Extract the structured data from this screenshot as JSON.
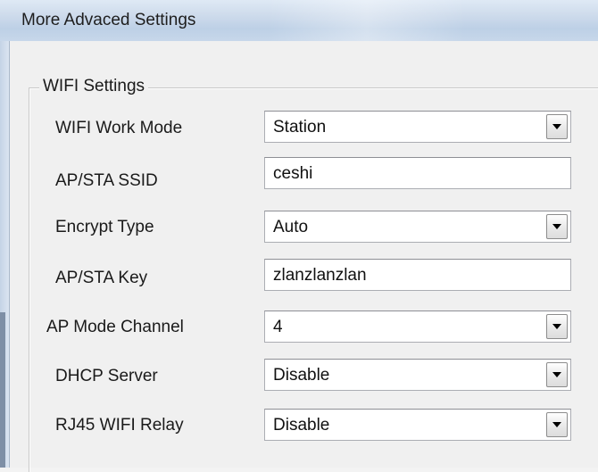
{
  "window": {
    "title": "More Advaced Settings"
  },
  "group": {
    "legend": "WIFI Settings"
  },
  "rows": [
    {
      "label": "WIFI Work Mode",
      "value": "Station",
      "control": "dropdown"
    },
    {
      "label": "AP/STA SSID",
      "value": "ceshi",
      "control": "text"
    },
    {
      "label": "Encrypt Type",
      "value": "Auto",
      "control": "dropdown"
    },
    {
      "label": "AP/STA Key",
      "value": "zlanzlanzlan",
      "control": "text"
    },
    {
      "label": "AP Mode Channel",
      "value": "4",
      "control": "dropdown"
    },
    {
      "label": "DHCP Server",
      "value": "Disable",
      "control": "dropdown"
    },
    {
      "label": "RJ45 WIFI Relay",
      "value": "Disable",
      "control": "dropdown"
    }
  ],
  "icons": {
    "dropdown_arrow": "chevron-down-icon"
  }
}
